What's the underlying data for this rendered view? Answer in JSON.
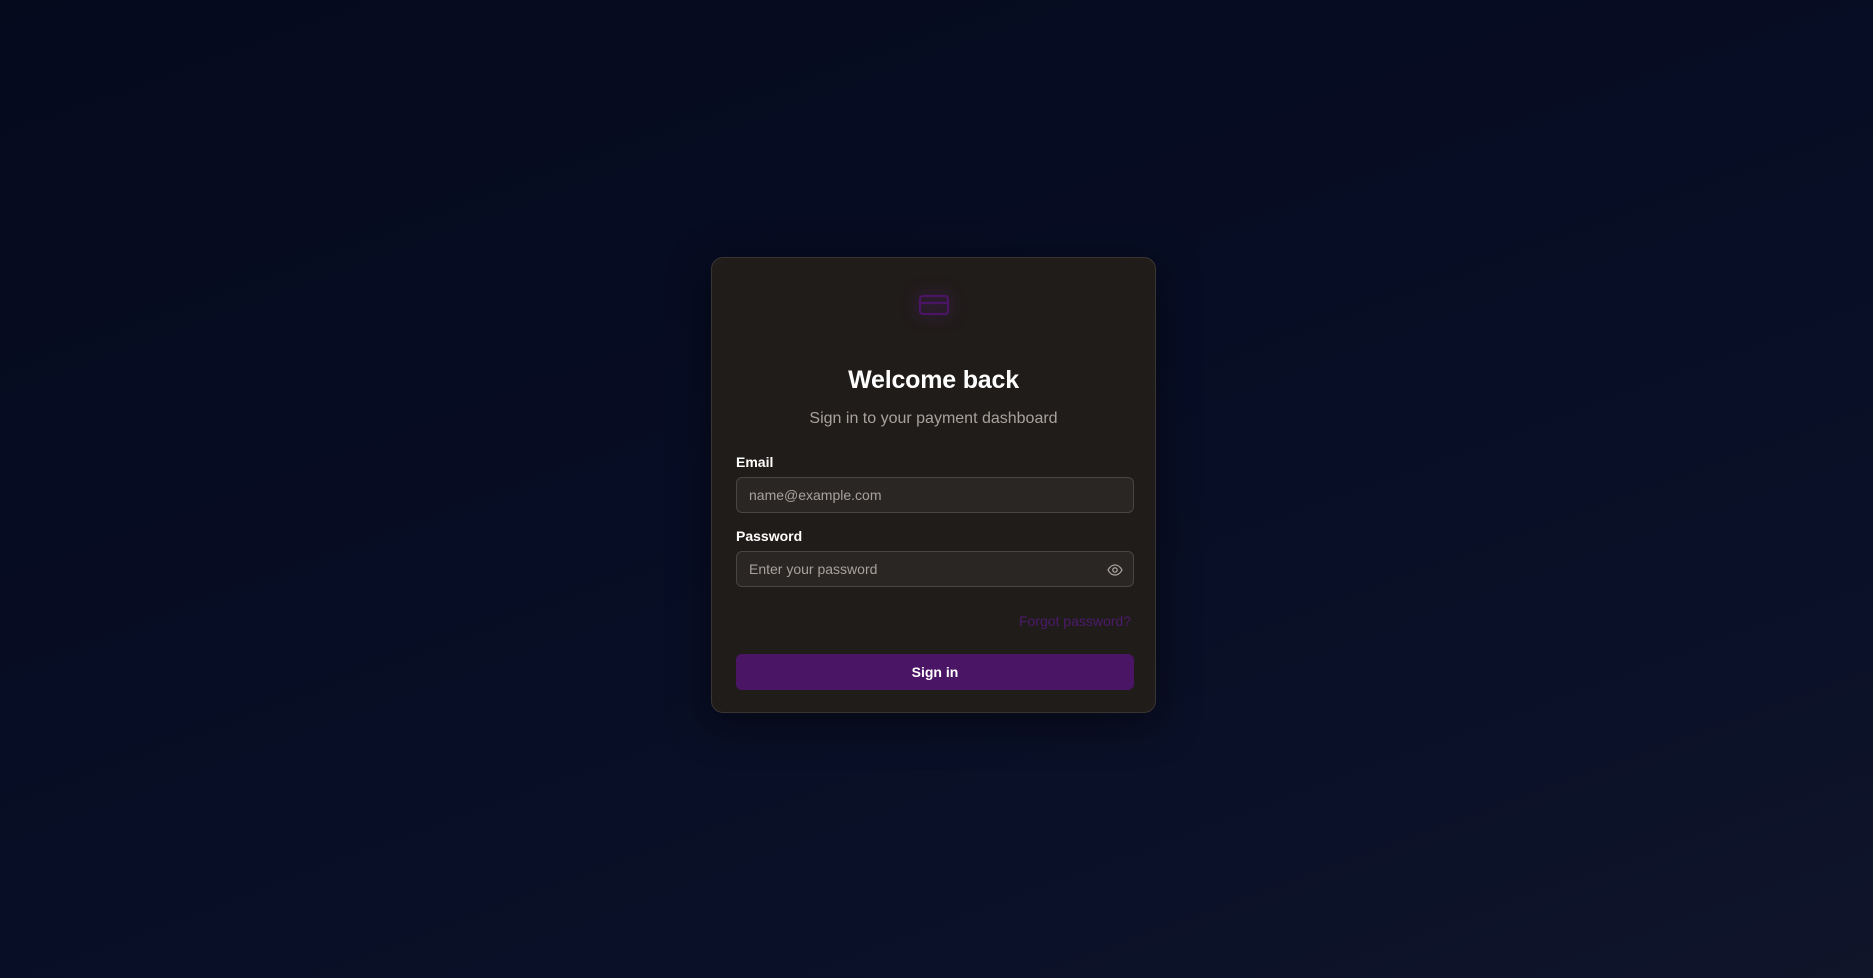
{
  "colors": {
    "accent": "#4b1566",
    "card_background": "#201c1a",
    "page_background": "#060b1f",
    "link": "#4c1a6b"
  },
  "logo": {
    "icon": "credit-card-icon"
  },
  "login": {
    "title": "Welcome back",
    "subtitle": "Sign in to your payment dashboard",
    "email": {
      "label": "Email",
      "placeholder": "name@example.com",
      "value": ""
    },
    "password": {
      "label": "Password",
      "placeholder": "Enter your password",
      "value": "",
      "toggle_icon": "eye-icon"
    },
    "forgot_label": "Forgot password?",
    "submit_label": "Sign in"
  }
}
